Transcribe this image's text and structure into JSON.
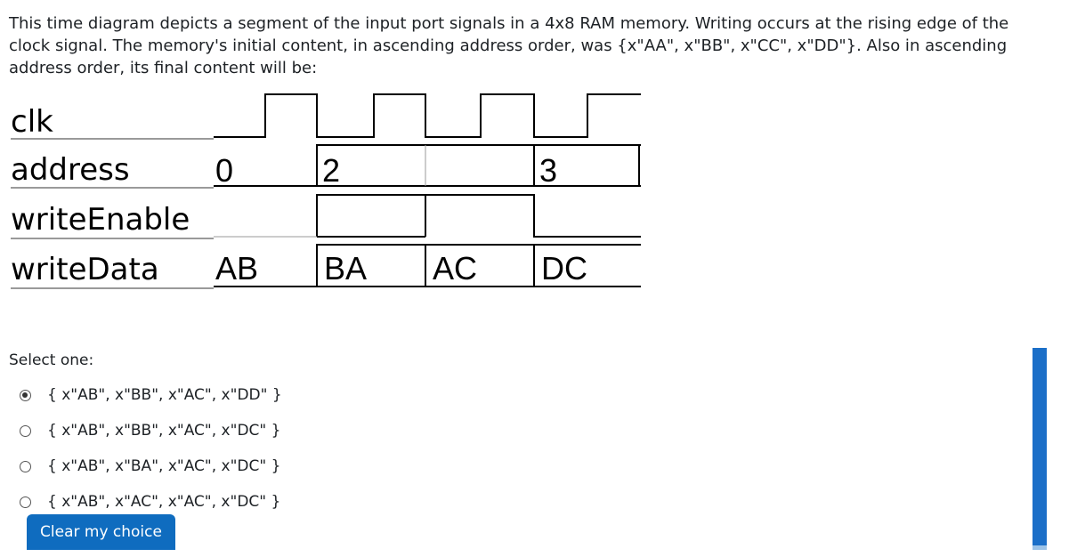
{
  "question": {
    "text": "This time diagram depicts a segment of the input port signals in a 4x8 RAM memory. Writing occurs at the rising edge of the clock signal. The memory's initial content, in ascending address order, was {x\"AA\", x\"BB\", x\"CC\", x\"DD\"}. Also in ascending address order, its final content will be:"
  },
  "diagram": {
    "signals": [
      {
        "name": "clk"
      },
      {
        "name": "address",
        "values": [
          "0",
          "2",
          "3"
        ]
      },
      {
        "name": "writeEnable"
      },
      {
        "name": "writeData",
        "values": [
          "AB",
          "BA",
          "AC",
          "DC"
        ]
      }
    ]
  },
  "answer": {
    "prompt": "Select one:",
    "options": [
      {
        "label": "{ x\"AB\", x\"BB\", x\"AC\", x\"DD\" }",
        "selected": true
      },
      {
        "label": "{ x\"AB\", x\"BB\", x\"AC\", x\"DC\" }",
        "selected": false
      },
      {
        "label": "{ x\"AB\", x\"BA\", x\"AC\", x\"DC\" }",
        "selected": false
      },
      {
        "label": "{ x\"AB\", x\"AC\", x\"AC\", x\"DC\" }",
        "selected": false
      }
    ],
    "clear_label": "Clear my choice"
  },
  "colors": {
    "accent": "#0f6cbf",
    "text": "#1d2125"
  }
}
